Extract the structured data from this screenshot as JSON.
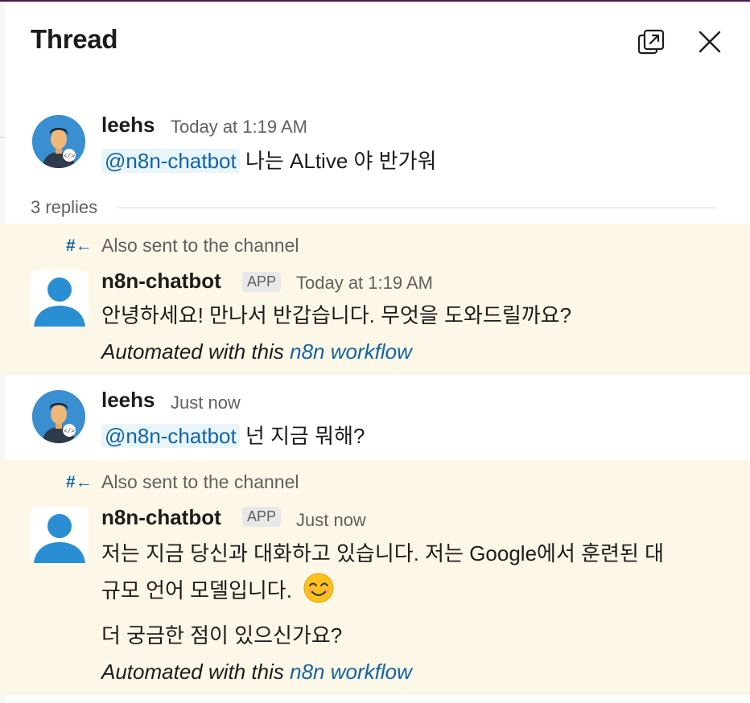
{
  "header": {
    "title": "Thread",
    "popout_icon": "popout-window-icon",
    "close_icon": "close-icon"
  },
  "parent": {
    "author": "leehs",
    "time": "Today at 1:19 AM",
    "mention": "@n8n-chatbot",
    "text": "나는 ALtive 야 반가워"
  },
  "replies_count": "3 replies",
  "messages": [
    {
      "also_sent": "Also sent to the channel",
      "author": "n8n-chatbot",
      "badge": "APP",
      "time": "Today at 1:19 AM",
      "line1": "안녕하세요! 만나서 반갑습니다. 무엇을 도와드릴까요?",
      "automated_prefix": "Automated with this",
      "automated_link": "n8n workflow"
    },
    {
      "author": "leehs",
      "time": "Just now",
      "mention": "@n8n-chatbot",
      "text": "넌 지금 뭐해?"
    },
    {
      "also_sent": "Also sent to the channel",
      "author": "n8n-chatbot",
      "badge": "APP",
      "time": "Just now",
      "line1": "저는 지금 당신과 대화하고 있습니다. 저는 Google에서 훈련된 대",
      "line2": "규모 언어 모델입니다.",
      "line3": "더 궁금한 점이 있으신가요?",
      "automated_prefix": "Automated with this",
      "automated_link": "n8n workflow"
    }
  ],
  "colors": {
    "link": "#1264a3",
    "bot_bg": "#fcf7e6",
    "mention_bg": "#e8f5fa",
    "muted": "#616061"
  }
}
